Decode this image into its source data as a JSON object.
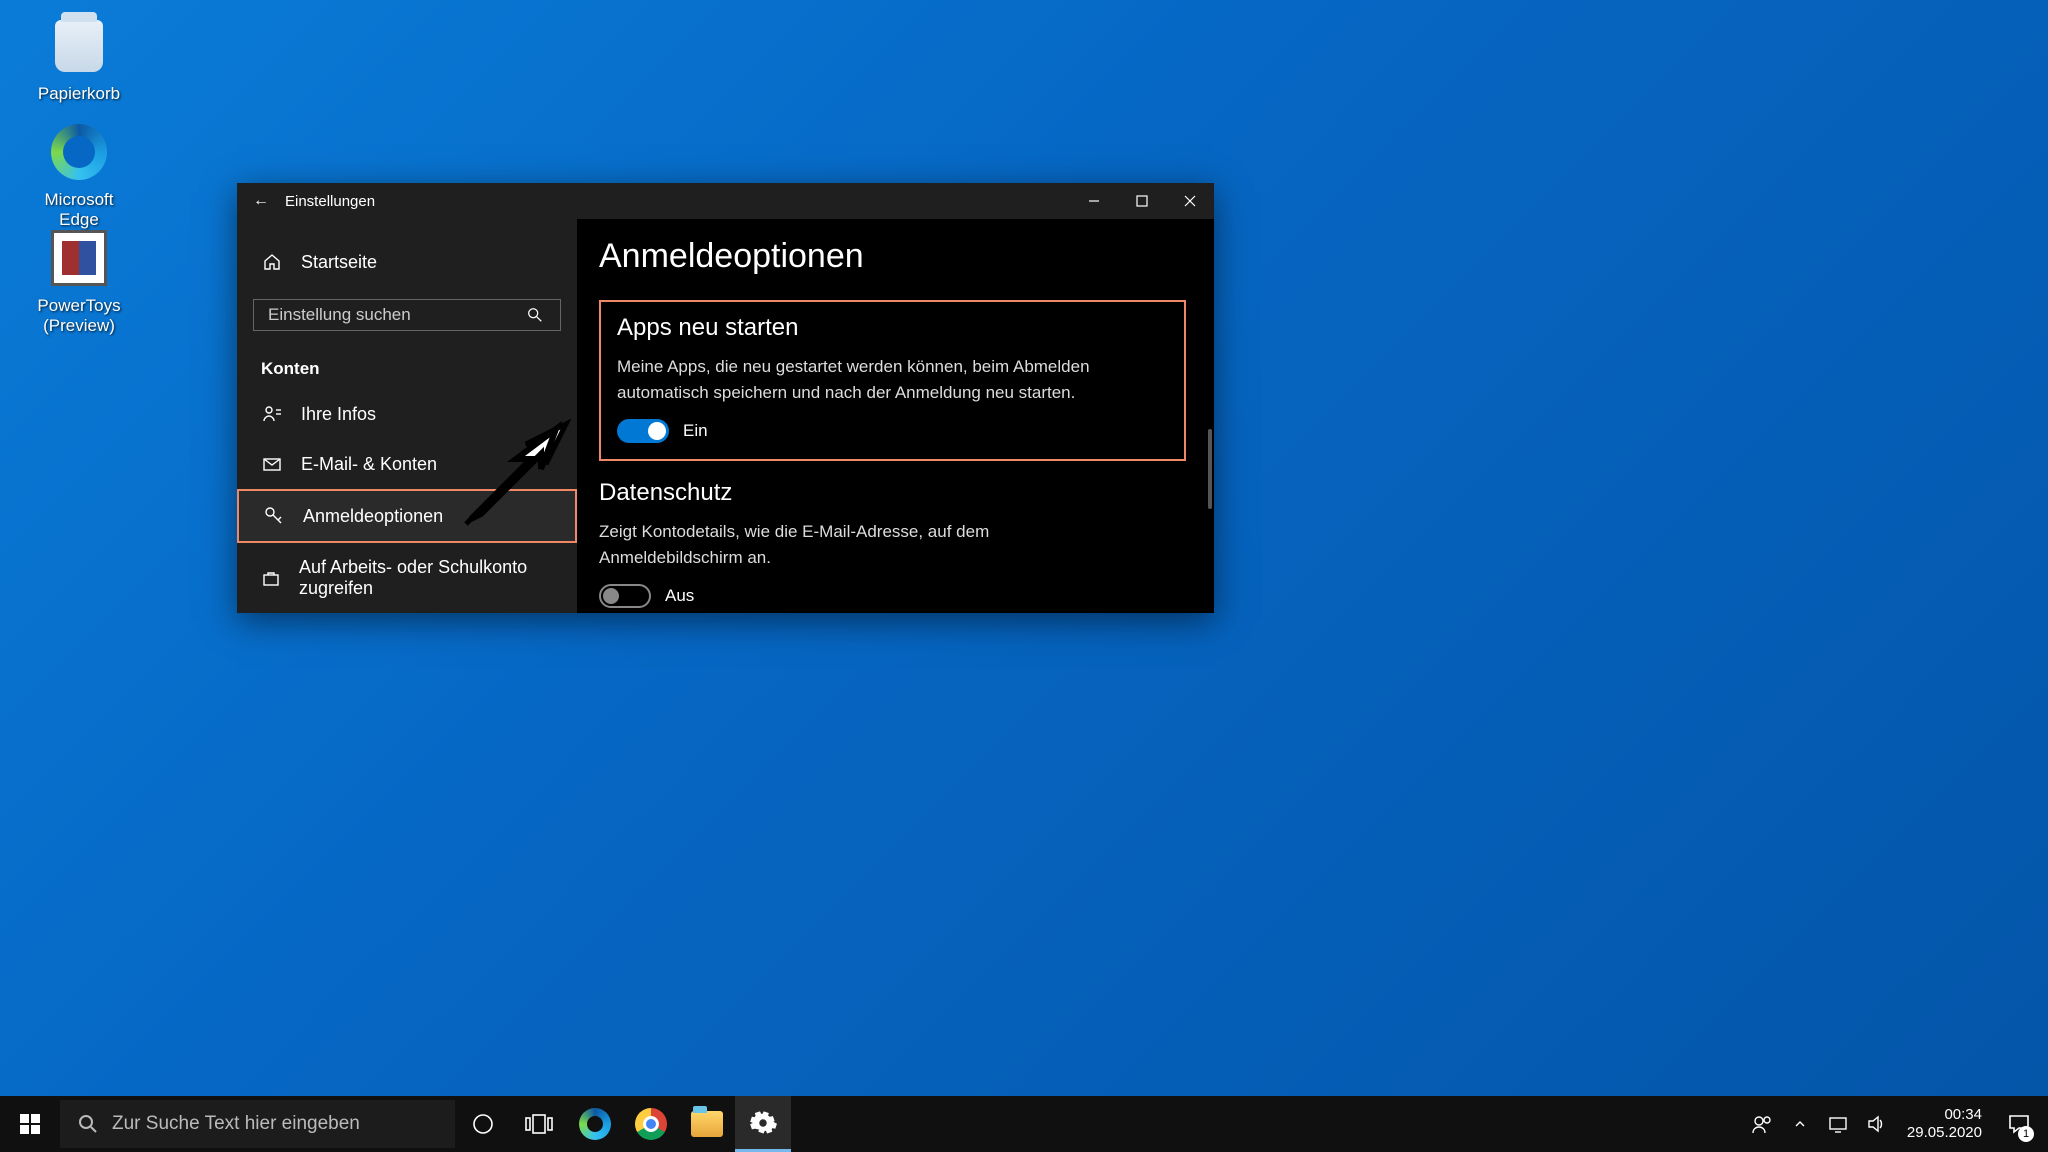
{
  "desktop": {
    "icons": [
      {
        "label": "Papierkorb"
      },
      {
        "label": "Microsoft Edge"
      },
      {
        "label": "PowerToys (Preview)"
      }
    ]
  },
  "window": {
    "title": "Einstellungen",
    "sidebar": {
      "home": "Startseite",
      "search_placeholder": "Einstellung suchen",
      "section": "Konten",
      "items": [
        {
          "label": "Ihre Infos"
        },
        {
          "label": "E-Mail- & Konten"
        },
        {
          "label": "Anmeldeoptionen"
        },
        {
          "label": "Auf Arbeits- oder Schulkonto zugreifen"
        }
      ]
    },
    "content": {
      "heading": "Anmeldeoptionen",
      "section1": {
        "title": "Apps neu starten",
        "desc": "Meine Apps, die neu gestartet werden können, beim Abmelden automatisch speichern und nach der Anmeldung neu starten.",
        "toggle_state": "Ein"
      },
      "section2": {
        "title": "Datenschutz",
        "desc": "Zeigt Kontodetails, wie die E-Mail-Adresse, auf dem Anmeldebildschirm an.",
        "toggle_state": "Aus"
      }
    }
  },
  "taskbar": {
    "search_placeholder": "Zur Suche Text hier eingeben",
    "clock": {
      "time": "00:34",
      "date": "29.05.2020"
    },
    "notif_count": "1"
  }
}
